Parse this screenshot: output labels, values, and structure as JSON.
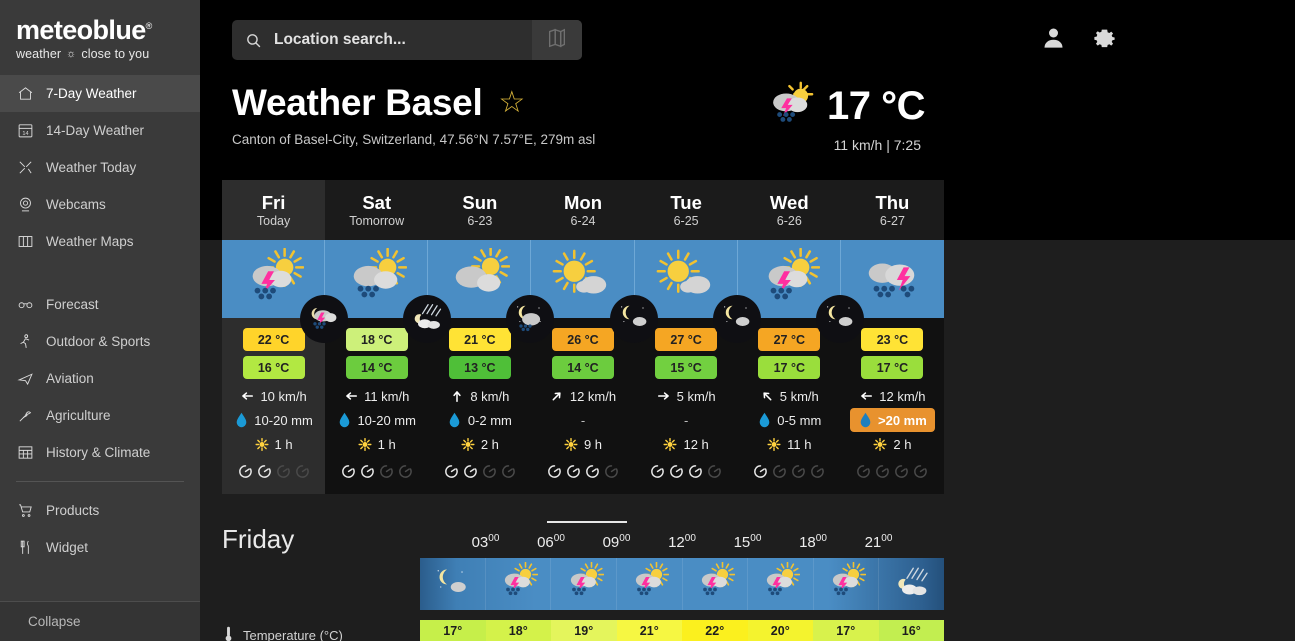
{
  "brand": {
    "name": "meteoblue",
    "registered": "®",
    "tagline_left": "weather",
    "tagline_right": "close to you"
  },
  "sidebar": {
    "items": [
      {
        "label": "7-Day Weather",
        "icon": "home-icon",
        "active": true
      },
      {
        "label": "14-Day Weather",
        "icon": "calendar-icon",
        "active": false
      },
      {
        "label": "Weather Today",
        "icon": "today-icon",
        "active": false
      },
      {
        "label": "Webcams",
        "icon": "webcam-icon",
        "active": false
      },
      {
        "label": "Weather Maps",
        "icon": "map-icon",
        "active": false
      }
    ],
    "items2": [
      {
        "label": "Forecast",
        "icon": "binoculars-icon"
      },
      {
        "label": "Outdoor & Sports",
        "icon": "runner-icon"
      },
      {
        "label": "Aviation",
        "icon": "airplane-icon"
      },
      {
        "label": "Agriculture",
        "icon": "wheat-icon"
      },
      {
        "label": "History & Climate",
        "icon": "table-icon"
      }
    ],
    "items3": [
      {
        "label": "Products",
        "icon": "cart-icon"
      },
      {
        "label": "Widget",
        "icon": "tools-icon"
      }
    ],
    "collapse": {
      "label": "Collapse",
      "icon": "chevron-left-icon"
    }
  },
  "search": {
    "placeholder": "Location search...",
    "value": "",
    "map_button_icon": "map-book-icon"
  },
  "topbar": {
    "account_icon": "user-icon",
    "settings_icon": "gear-icon"
  },
  "header": {
    "title": "Weather Basel",
    "favorite_icon": "star-icon",
    "subtitle": "Canton of Basel-City, Switzerland, 47.56°N 7.57°E, 279m asl",
    "current": {
      "icon": "thunderstorm-sun-icon",
      "temperature": "17 °C",
      "wind": "11 km/h",
      "separator": "|",
      "time": "7:25"
    }
  },
  "forecast": {
    "days": [
      {
        "name": "Fri",
        "date": "Today",
        "active": true,
        "day_icon": "thunderstorm-sun-icon",
        "night_icon": "thunderstorm-night-icon",
        "tmax": "22 °C",
        "tmax_color": "#ffd42a",
        "tmin": "16 °C",
        "tmin_color": "#b2e842",
        "wind": "10 km/h",
        "wind_dir": "E",
        "precip": "10-20 mm",
        "precip_high": false,
        "sun": "1 h",
        "meters_filled": 2,
        "meters_total": 4
      },
      {
        "name": "Sat",
        "date": "Tomorrow",
        "active": false,
        "day_icon": "rain-sun-icon",
        "night_icon": "rain-night-icon",
        "tmax": "18 °C",
        "tmax_color": "#cdf07a",
        "tmin": "14 °C",
        "tmin_color": "#6ccc3e",
        "wind": "11 km/h",
        "wind_dir": "E",
        "precip": "10-20 mm",
        "precip_high": false,
        "sun": "1 h",
        "meters_filled": 2,
        "meters_total": 4
      },
      {
        "name": "Sun",
        "date": "6-23",
        "active": false,
        "day_icon": "cloudy-sun-icon",
        "night_icon": "cloudy-night-icon",
        "tmax": "21 °C",
        "tmax_color": "#ffe335",
        "tmin": "13 °C",
        "tmin_color": "#4fbf38",
        "wind": "8 km/h",
        "wind_dir": "S",
        "precip": "0-2 mm",
        "precip_high": false,
        "sun": "2 h",
        "meters_filled": 2,
        "meters_total": 4
      },
      {
        "name": "Mon",
        "date": "6-24",
        "active": false,
        "day_icon": "sunny-cloud-icon",
        "night_icon": "clear-night-icon",
        "tmax": "26 °C",
        "tmax_color": "#f5a623",
        "tmin": "14 °C",
        "tmin_color": "#6ccc3e",
        "wind": "12 km/h",
        "wind_dir": "SW",
        "precip": "-",
        "precip_high": false,
        "sun": "9 h",
        "meters_filled": 3,
        "meters_total": 4
      },
      {
        "name": "Tue",
        "date": "6-25",
        "active": false,
        "day_icon": "sunny-cloud-icon",
        "night_icon": "clear-night-icon",
        "tmax": "27 °C",
        "tmax_color": "#f5a623",
        "tmin": "15 °C",
        "tmin_color": "#72d040",
        "wind": "5 km/h",
        "wind_dir": "W",
        "precip": "-",
        "precip_high": false,
        "sun": "12 h",
        "meters_filled": 3,
        "meters_total": 4
      },
      {
        "name": "Wed",
        "date": "6-26",
        "active": false,
        "day_icon": "thunderstorm-sun-icon",
        "night_icon": "clear-night-icon",
        "tmax": "27 °C",
        "tmax_color": "#f5a623",
        "tmin": "17 °C",
        "tmin_color": "#9ade3c",
        "wind": "5 km/h",
        "wind_dir": "SE",
        "precip": "0-5 mm",
        "precip_high": false,
        "sun": "11 h",
        "meters_filled": 1,
        "meters_total": 4
      },
      {
        "name": "Thu",
        "date": "6-27",
        "active": false,
        "day_icon": "thunderstorm-rain-icon",
        "night_icon": "clear-night-icon",
        "tmax": "23 °C",
        "tmax_color": "#ffe335",
        "tmin": "17 °C",
        "tmin_color": "#9ade3c",
        "wind": "12 km/h",
        "wind_dir": "E",
        "precip": ">20 mm",
        "precip_high": true,
        "sun": "2 h",
        "meters_filled": 0,
        "meters_total": 4
      }
    ]
  },
  "hourly": {
    "day_label": "Friday",
    "temperature_row_label": "Temperature (°C)",
    "temperature_row_icon": "thermometer-icon",
    "ticks": [
      {
        "hour": "03",
        "min": "00"
      },
      {
        "hour": "06",
        "min": "00"
      },
      {
        "hour": "09",
        "min": "00"
      },
      {
        "hour": "12",
        "min": "00"
      },
      {
        "hour": "15",
        "min": "00"
      },
      {
        "hour": "18",
        "min": "00"
      },
      {
        "hour": "21",
        "min": "00"
      }
    ],
    "cells": [
      {
        "icon": "clear-night-icon",
        "temp": "17°",
        "color": "#c6ef4a"
      },
      {
        "icon": "thunderstorm-sun-icon",
        "temp": "18°",
        "color": "#d4f24a"
      },
      {
        "icon": "thunderstorm-sun-icon",
        "temp": "19°",
        "color": "#e4f55c"
      },
      {
        "icon": "thunderstorm-sun-icon",
        "temp": "21°",
        "color": "#f6f742"
      },
      {
        "icon": "thunderstorm-sun-icon",
        "temp": "22°",
        "color": "#fbf01e"
      },
      {
        "icon": "thunderstorm-sun-icon",
        "temp": "20°",
        "color": "#f4f32e"
      },
      {
        "icon": "thunderstorm-sun-icon",
        "temp": "17°",
        "color": "#d8f24c"
      },
      {
        "icon": "rain-night-icon",
        "temp": "16°",
        "color": "#c2ee50"
      }
    ]
  }
}
